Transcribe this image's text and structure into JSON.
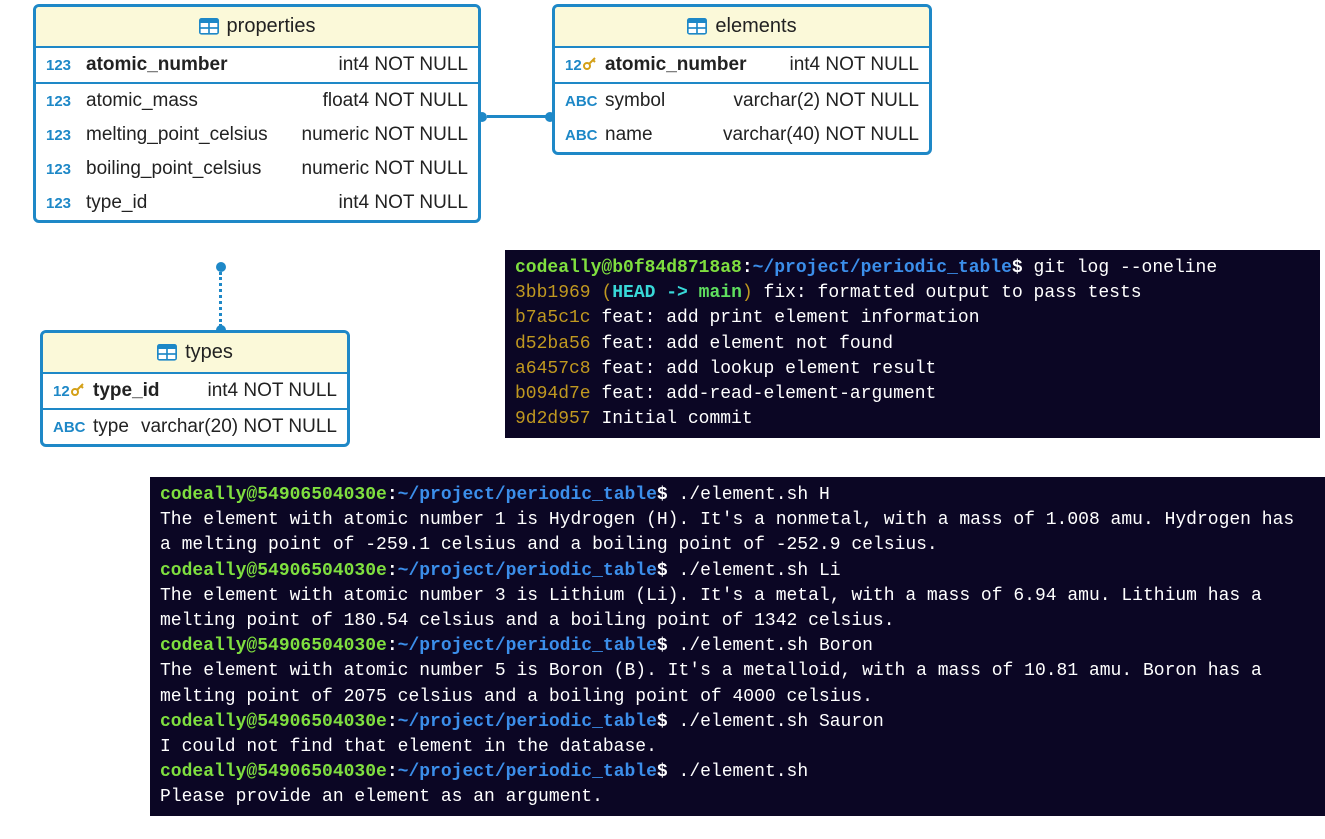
{
  "tables": {
    "properties": {
      "title": "properties",
      "columns": [
        {
          "icon": "123",
          "name": "atomic_number",
          "type": "int4 NOT NULL",
          "bold": true,
          "key": false
        },
        {
          "icon": "123",
          "name": "atomic_mass",
          "type": "float4 NOT NULL",
          "bold": false,
          "key": false
        },
        {
          "icon": "123",
          "name": "melting_point_celsius",
          "type": "numeric NOT NULL",
          "bold": false,
          "key": false
        },
        {
          "icon": "123",
          "name": "boiling_point_celsius",
          "type": "numeric NOT NULL",
          "bold": false,
          "key": false
        },
        {
          "icon": "123",
          "name": "type_id",
          "type": "int4 NOT NULL",
          "bold": false,
          "key": false
        }
      ]
    },
    "elements": {
      "title": "elements",
      "columns": [
        {
          "icon": "123",
          "name": "atomic_number",
          "type": "int4 NOT NULL",
          "bold": true,
          "key": true
        },
        {
          "icon": "ABC",
          "name": "symbol",
          "type": "varchar(2) NOT NULL",
          "bold": false,
          "key": false
        },
        {
          "icon": "ABC",
          "name": "name",
          "type": "varchar(40) NOT NULL",
          "bold": false,
          "key": false
        }
      ]
    },
    "types": {
      "title": "types",
      "columns": [
        {
          "icon": "123",
          "name": "type_id",
          "type": "int4 NOT NULL",
          "bold": true,
          "key": true
        },
        {
          "icon": "ABC",
          "name": "type",
          "type": "varchar(20) NOT NULL",
          "bold": false,
          "key": false
        }
      ]
    }
  },
  "terminal1": {
    "user": "codeally@b0f84d8718a8",
    "path": "~/project/periodic_table",
    "command": "git log --oneline",
    "log": [
      {
        "hash": "3bb1969",
        "refs": "(HEAD -> main)",
        "msg": "fix: formatted output to pass tests"
      },
      {
        "hash": "b7a5c1c",
        "refs": "",
        "msg": "feat: add print element information"
      },
      {
        "hash": "d52ba56",
        "refs": "",
        "msg": "feat: add element not found"
      },
      {
        "hash": "a6457c8",
        "refs": "",
        "msg": "feat: add lookup element result"
      },
      {
        "hash": "b094d7e",
        "refs": "",
        "msg": "feat: add-read-element-argument"
      },
      {
        "hash": "9d2d957",
        "refs": "",
        "msg": "Initial commit"
      }
    ]
  },
  "terminal2": {
    "user": "codeally@54906504030e",
    "path": "~/project/periodic_table",
    "sessions": [
      {
        "cmd": "./element.sh H",
        "out": "The element with atomic number 1 is Hydrogen (H). It's a nonmetal, with a mass of 1.008 amu. Hydrogen has a melting point of -259.1 celsius and a boiling point of -252.9 celsius."
      },
      {
        "cmd": "./element.sh Li",
        "out": "The element with atomic number 3 is Lithium (Li). It's a metal, with a mass of 6.94 amu. Lithium has a melting point of 180.54 celsius and a boiling point of 1342 celsius."
      },
      {
        "cmd": "./element.sh Boron",
        "out": "The element with atomic number 5 is Boron (B). It's a metalloid, with a mass of 10.81 amu. Boron has a melting point of 2075 celsius and a boiling point of 4000 celsius."
      },
      {
        "cmd": "./element.sh Sauron",
        "out": "I could not find that element in the database."
      },
      {
        "cmd": "./element.sh",
        "out": "Please provide an element as an argument."
      }
    ]
  }
}
